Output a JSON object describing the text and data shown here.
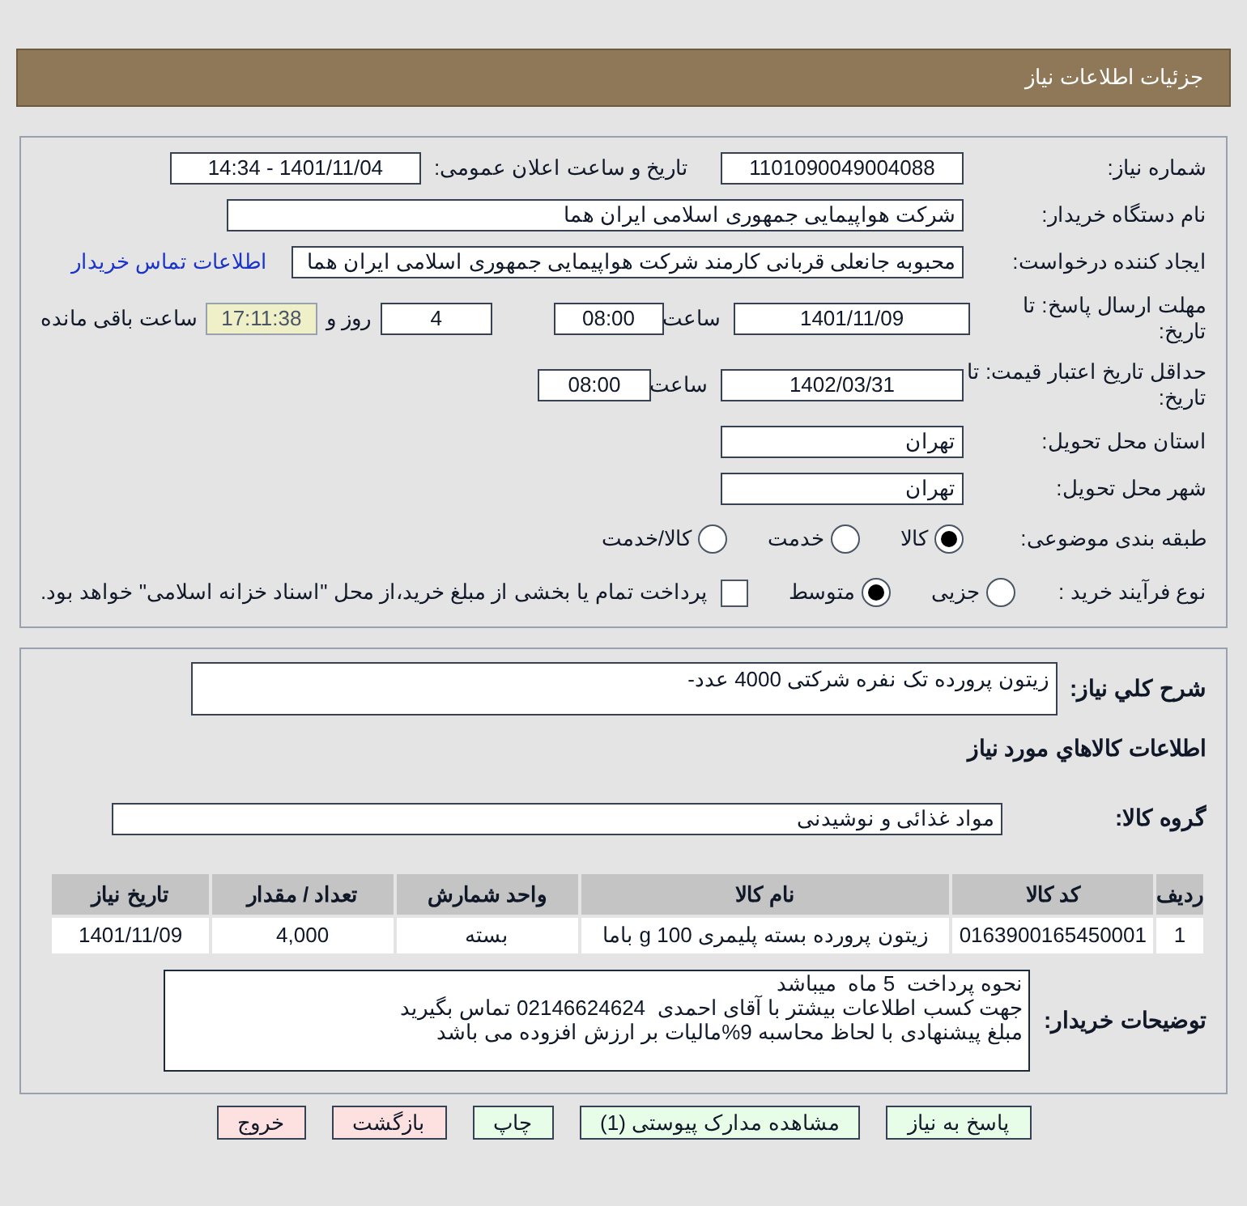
{
  "header": {
    "title": "جزئیات اطلاعات نیاز"
  },
  "fields": {
    "need_number": {
      "label": "شماره نیاز:",
      "value": "1101090049004088"
    },
    "announce": {
      "label": "تاریخ و ساعت اعلان عمومی:",
      "value": "1401/11/04 - 14:34"
    },
    "buyer": {
      "label": "نام دستگاه خریدار:",
      "value": "شرکت هواپیمایی جمهوری اسلامی ایران هما"
    },
    "requester": {
      "label": "ایجاد کننده درخواست:",
      "value": "محبوبه جانعلی قربانی کارمند شرکت هواپیمایی جمهوری اسلامی ایران هما",
      "link": "اطلاعات تماس خریدار"
    },
    "deadline": {
      "label": "مهلت ارسال پاسخ: تا تاریخ:",
      "date": "1401/11/09",
      "time_label": "ساعت",
      "time": "08:00",
      "days": "4",
      "days_label": "روز و",
      "remaining": "17:11:38",
      "remaining_label": "ساعت باقی مانده"
    },
    "validity": {
      "label": "حداقل تاریخ اعتبار قیمت: تا تاریخ:",
      "date": "1402/03/31",
      "time_label": "ساعت",
      "time": "08:00"
    },
    "province": {
      "label": "استان محل تحویل:",
      "value": "تهران"
    },
    "city": {
      "label": "شهر محل تحویل:",
      "value": "تهران"
    }
  },
  "category": {
    "label": "طبقه بندی موضوعی:",
    "options": [
      {
        "label": "کالا",
        "selected": true
      },
      {
        "label": "خدمت",
        "selected": false
      },
      {
        "label": "کالا/خدمت",
        "selected": false
      }
    ]
  },
  "process": {
    "label": "نوع فرآیند خرید :",
    "options": [
      {
        "label": "جزیی",
        "selected": false
      },
      {
        "label": "متوسط",
        "selected": true
      }
    ],
    "treasury": {
      "checked": false,
      "label": "پرداخت تمام یا بخشی از مبلغ خرید،از محل \"اسناد خزانه اسلامی\" خواهد بود."
    }
  },
  "summary": {
    "label": "شرح کلي نياز:",
    "value": "زیتون پرورده تک نفره شرکتی 4000 عدد-"
  },
  "goods_title": "اطلاعات کالاهاي مورد نياز",
  "group": {
    "label": "گروه کالا:",
    "value": "مواد غذائی و نوشیدنی"
  },
  "table": {
    "columns": [
      "ردیف",
      "کد کالا",
      "نام کالا",
      "واحد شمارش",
      "تعداد / مقدار",
      "تاریخ نیاز"
    ],
    "rows": [
      [
        "1",
        "0163900165450001",
        "زیتون پرورده بسته پلیمری 100 g باما",
        "بسته",
        "4,000",
        "1401/11/09"
      ]
    ]
  },
  "notes": {
    "label": "توضیحات خریدار:",
    "lines": [
      "نحوه پرداخت  5 ماه  میباشد",
      "جهت کسب اطلاعات بیشتر با آقای احمدی  02146624624 تماس بگیرید",
      "مبلغ پیشنهادی با لحاظ محاسبه 9%مالیات بر ارزش افزوده می باشد"
    ]
  },
  "buttons": [
    {
      "label": "پاسخ به نیاز",
      "kind": "green"
    },
    {
      "label": "مشاهده مدارک پیوستی (1)",
      "kind": "green"
    },
    {
      "label": "چاپ",
      "kind": "green"
    },
    {
      "label": "بازگشت",
      "kind": "red"
    },
    {
      "label": "خروج",
      "kind": "red"
    }
  ]
}
